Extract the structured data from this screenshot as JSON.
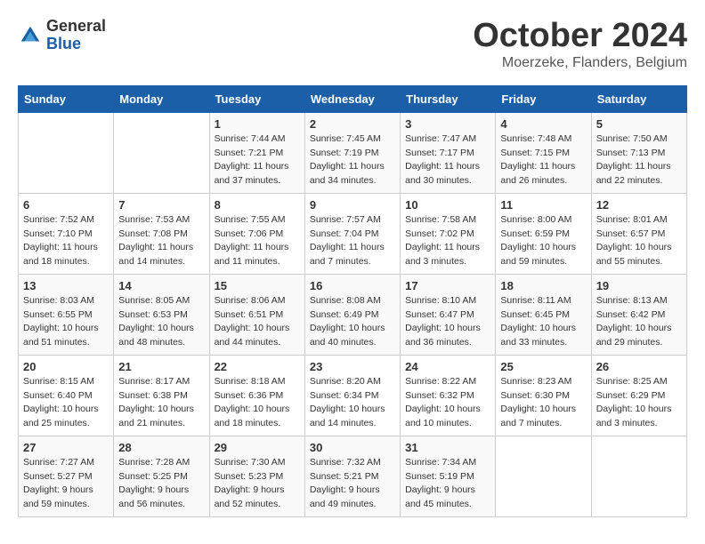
{
  "header": {
    "logo_general": "General",
    "logo_blue": "Blue",
    "month_title": "October 2024",
    "location": "Moerzeke, Flanders, Belgium"
  },
  "days_of_week": [
    "Sunday",
    "Monday",
    "Tuesday",
    "Wednesday",
    "Thursday",
    "Friday",
    "Saturday"
  ],
  "weeks": [
    [
      {
        "day": "",
        "sunrise": "",
        "sunset": "",
        "daylight": ""
      },
      {
        "day": "",
        "sunrise": "",
        "sunset": "",
        "daylight": ""
      },
      {
        "day": "1",
        "sunrise": "Sunrise: 7:44 AM",
        "sunset": "Sunset: 7:21 PM",
        "daylight": "Daylight: 11 hours and 37 minutes."
      },
      {
        "day": "2",
        "sunrise": "Sunrise: 7:45 AM",
        "sunset": "Sunset: 7:19 PM",
        "daylight": "Daylight: 11 hours and 34 minutes."
      },
      {
        "day": "3",
        "sunrise": "Sunrise: 7:47 AM",
        "sunset": "Sunset: 7:17 PM",
        "daylight": "Daylight: 11 hours and 30 minutes."
      },
      {
        "day": "4",
        "sunrise": "Sunrise: 7:48 AM",
        "sunset": "Sunset: 7:15 PM",
        "daylight": "Daylight: 11 hours and 26 minutes."
      },
      {
        "day": "5",
        "sunrise": "Sunrise: 7:50 AM",
        "sunset": "Sunset: 7:13 PM",
        "daylight": "Daylight: 11 hours and 22 minutes."
      }
    ],
    [
      {
        "day": "6",
        "sunrise": "Sunrise: 7:52 AM",
        "sunset": "Sunset: 7:10 PM",
        "daylight": "Daylight: 11 hours and 18 minutes."
      },
      {
        "day": "7",
        "sunrise": "Sunrise: 7:53 AM",
        "sunset": "Sunset: 7:08 PM",
        "daylight": "Daylight: 11 hours and 14 minutes."
      },
      {
        "day": "8",
        "sunrise": "Sunrise: 7:55 AM",
        "sunset": "Sunset: 7:06 PM",
        "daylight": "Daylight: 11 hours and 11 minutes."
      },
      {
        "day": "9",
        "sunrise": "Sunrise: 7:57 AM",
        "sunset": "Sunset: 7:04 PM",
        "daylight": "Daylight: 11 hours and 7 minutes."
      },
      {
        "day": "10",
        "sunrise": "Sunrise: 7:58 AM",
        "sunset": "Sunset: 7:02 PM",
        "daylight": "Daylight: 11 hours and 3 minutes."
      },
      {
        "day": "11",
        "sunrise": "Sunrise: 8:00 AM",
        "sunset": "Sunset: 6:59 PM",
        "daylight": "Daylight: 10 hours and 59 minutes."
      },
      {
        "day": "12",
        "sunrise": "Sunrise: 8:01 AM",
        "sunset": "Sunset: 6:57 PM",
        "daylight": "Daylight: 10 hours and 55 minutes."
      }
    ],
    [
      {
        "day": "13",
        "sunrise": "Sunrise: 8:03 AM",
        "sunset": "Sunset: 6:55 PM",
        "daylight": "Daylight: 10 hours and 51 minutes."
      },
      {
        "day": "14",
        "sunrise": "Sunrise: 8:05 AM",
        "sunset": "Sunset: 6:53 PM",
        "daylight": "Daylight: 10 hours and 48 minutes."
      },
      {
        "day": "15",
        "sunrise": "Sunrise: 8:06 AM",
        "sunset": "Sunset: 6:51 PM",
        "daylight": "Daylight: 10 hours and 44 minutes."
      },
      {
        "day": "16",
        "sunrise": "Sunrise: 8:08 AM",
        "sunset": "Sunset: 6:49 PM",
        "daylight": "Daylight: 10 hours and 40 minutes."
      },
      {
        "day": "17",
        "sunrise": "Sunrise: 8:10 AM",
        "sunset": "Sunset: 6:47 PM",
        "daylight": "Daylight: 10 hours and 36 minutes."
      },
      {
        "day": "18",
        "sunrise": "Sunrise: 8:11 AM",
        "sunset": "Sunset: 6:45 PM",
        "daylight": "Daylight: 10 hours and 33 minutes."
      },
      {
        "day": "19",
        "sunrise": "Sunrise: 8:13 AM",
        "sunset": "Sunset: 6:42 PM",
        "daylight": "Daylight: 10 hours and 29 minutes."
      }
    ],
    [
      {
        "day": "20",
        "sunrise": "Sunrise: 8:15 AM",
        "sunset": "Sunset: 6:40 PM",
        "daylight": "Daylight: 10 hours and 25 minutes."
      },
      {
        "day": "21",
        "sunrise": "Sunrise: 8:17 AM",
        "sunset": "Sunset: 6:38 PM",
        "daylight": "Daylight: 10 hours and 21 minutes."
      },
      {
        "day": "22",
        "sunrise": "Sunrise: 8:18 AM",
        "sunset": "Sunset: 6:36 PM",
        "daylight": "Daylight: 10 hours and 18 minutes."
      },
      {
        "day": "23",
        "sunrise": "Sunrise: 8:20 AM",
        "sunset": "Sunset: 6:34 PM",
        "daylight": "Daylight: 10 hours and 14 minutes."
      },
      {
        "day": "24",
        "sunrise": "Sunrise: 8:22 AM",
        "sunset": "Sunset: 6:32 PM",
        "daylight": "Daylight: 10 hours and 10 minutes."
      },
      {
        "day": "25",
        "sunrise": "Sunrise: 8:23 AM",
        "sunset": "Sunset: 6:30 PM",
        "daylight": "Daylight: 10 hours and 7 minutes."
      },
      {
        "day": "26",
        "sunrise": "Sunrise: 8:25 AM",
        "sunset": "Sunset: 6:29 PM",
        "daylight": "Daylight: 10 hours and 3 minutes."
      }
    ],
    [
      {
        "day": "27",
        "sunrise": "Sunrise: 7:27 AM",
        "sunset": "Sunset: 5:27 PM",
        "daylight": "Daylight: 9 hours and 59 minutes."
      },
      {
        "day": "28",
        "sunrise": "Sunrise: 7:28 AM",
        "sunset": "Sunset: 5:25 PM",
        "daylight": "Daylight: 9 hours and 56 minutes."
      },
      {
        "day": "29",
        "sunrise": "Sunrise: 7:30 AM",
        "sunset": "Sunset: 5:23 PM",
        "daylight": "Daylight: 9 hours and 52 minutes."
      },
      {
        "day": "30",
        "sunrise": "Sunrise: 7:32 AM",
        "sunset": "Sunset: 5:21 PM",
        "daylight": "Daylight: 9 hours and 49 minutes."
      },
      {
        "day": "31",
        "sunrise": "Sunrise: 7:34 AM",
        "sunset": "Sunset: 5:19 PM",
        "daylight": "Daylight: 9 hours and 45 minutes."
      },
      {
        "day": "",
        "sunrise": "",
        "sunset": "",
        "daylight": ""
      },
      {
        "day": "",
        "sunrise": "",
        "sunset": "",
        "daylight": ""
      }
    ]
  ]
}
